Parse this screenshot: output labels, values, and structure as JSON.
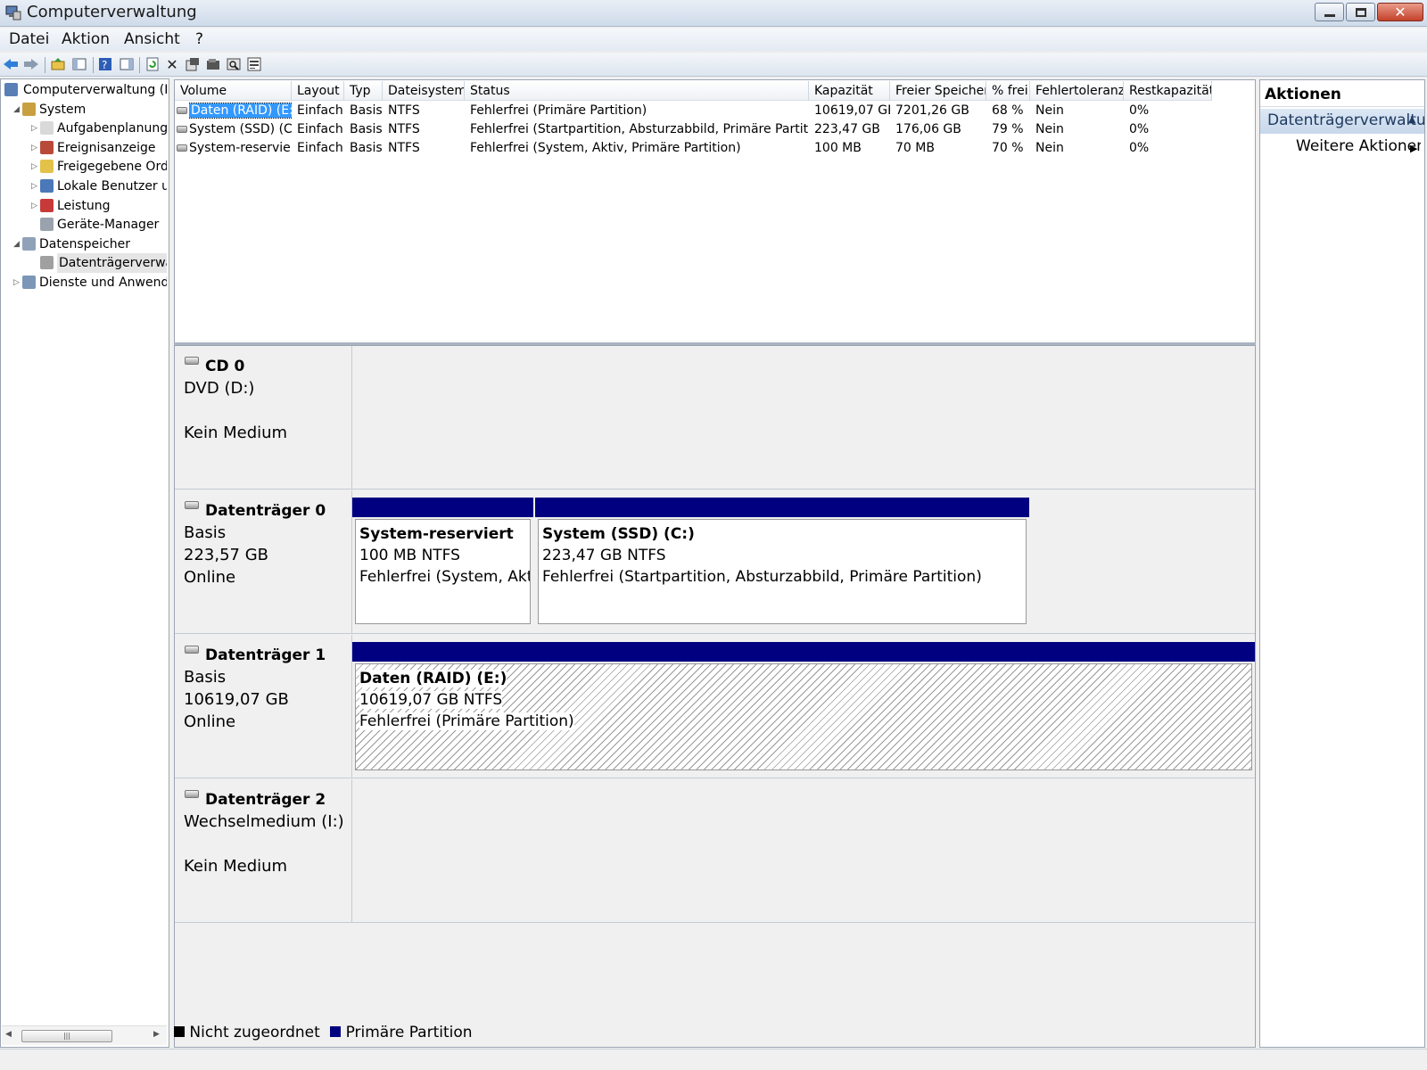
{
  "window": {
    "title": "Computerverwaltung"
  },
  "menu": [
    "Datei",
    "Aktion",
    "Ansicht",
    "?"
  ],
  "toolbar_icons": [
    "back-icon",
    "forward-icon",
    "up-folder-icon",
    "show-hide-tree-icon",
    "help-icon",
    "show-hide-action-pane-icon",
    "refresh-icon",
    "delete-icon",
    "properties-icon",
    "open-icon",
    "search-icon",
    "export-list-icon"
  ],
  "tree": [
    {
      "label": "Computerverwaltung (Lokal)",
      "level": 0,
      "expander": "",
      "icon": "computer-management-icon"
    },
    {
      "label": "System",
      "level": 1,
      "expander": "expanded",
      "icon": "system-tools-icon"
    },
    {
      "label": "Aufgabenplanung",
      "level": 2,
      "expander": "collapsed",
      "icon": "task-scheduler-icon"
    },
    {
      "label": "Ereignisanzeige",
      "level": 2,
      "expander": "collapsed",
      "icon": "event-viewer-icon"
    },
    {
      "label": "Freigegebene Ordner",
      "level": 2,
      "expander": "collapsed",
      "icon": "shared-folders-icon"
    },
    {
      "label": "Lokale Benutzer und Gruppen",
      "level": 2,
      "expander": "collapsed",
      "icon": "local-users-icon"
    },
    {
      "label": "Leistung",
      "level": 2,
      "expander": "collapsed",
      "icon": "performance-icon"
    },
    {
      "label": "Geräte-Manager",
      "level": 2,
      "expander": "",
      "icon": "device-manager-icon"
    },
    {
      "label": "Datenspeicher",
      "level": 1,
      "expander": "expanded",
      "icon": "storage-icon"
    },
    {
      "label": "Datenträgerverwaltung",
      "level": 2,
      "expander": "",
      "icon": "disk-management-icon",
      "selected": true
    },
    {
      "label": "Dienste und Anwendungen",
      "level": 1,
      "expander": "collapsed",
      "icon": "services-icon"
    }
  ],
  "volume_table": {
    "columns": [
      "Volume",
      "Layout",
      "Typ",
      "Dateisystem",
      "Status",
      "Kapazität",
      "Freier Speicher",
      "% frei",
      "Fehlertoleranz",
      "Restkapazität"
    ],
    "rows": [
      [
        "Daten (RAID) (E:)",
        "Einfach",
        "Basis",
        "NTFS",
        "Fehlerfrei (Primäre Partition)",
        "10619,07 GB",
        "7201,26 GB",
        "68 %",
        "Nein",
        "0%"
      ],
      [
        "System (SSD) (C:)",
        "Einfach",
        "Basis",
        "NTFS",
        "Fehlerfrei (Startpartition, Absturzabbild, Primäre Partition)",
        "223,47 GB",
        "176,06 GB",
        "79 %",
        "Nein",
        "0%"
      ],
      [
        "System-reserviert",
        "Einfach",
        "Basis",
        "NTFS",
        "Fehlerfrei (System, Aktiv, Primäre Partition)",
        "100 MB",
        "70 MB",
        "70 %",
        "Nein",
        "0%"
      ]
    ]
  },
  "disks": [
    {
      "name": "CD 0",
      "lines": [
        "DVD (D:)",
        "",
        "Kein Medium"
      ],
      "icon": "cd-drive-icon",
      "partitions": []
    },
    {
      "name": "Datenträger 0",
      "lines": [
        "Basis",
        "223,57 GB",
        "Online"
      ],
      "icon": "hard-disk-icon",
      "partitions": [
        {
          "name": "System-reserviert",
          "size": "100 MB NTFS",
          "status": "Fehlerfrei (System, Aktiv, Primäre Partition)"
        },
        {
          "name": "System (SSD)  (C:)",
          "size": "223,47 GB NTFS",
          "status": "Fehlerfrei (Startpartition, Absturzabbild, Primäre Partition)"
        }
      ]
    },
    {
      "name": "Datenträger 1",
      "lines": [
        "Basis",
        "10619,07 GB",
        "Online"
      ],
      "icon": "hard-disk-icon",
      "partitions": [
        {
          "name": "Daten (RAID)  (E:)",
          "size": "10619,07 GB NTFS",
          "status": "Fehlerfrei (Primäre Partition)"
        }
      ]
    },
    {
      "name": "Datenträger 2",
      "lines": [
        "Wechselmedium (I:)",
        "",
        "Kein Medium"
      ],
      "icon": "removable-disk-icon",
      "partitions": []
    }
  ],
  "legend": [
    {
      "label": "Nicht zugeordnet",
      "color": "#000000"
    },
    {
      "label": "Primäre Partition",
      "color": "#000080"
    }
  ],
  "actions": {
    "title": "Aktionen",
    "section": "Datenträgerverwaltung",
    "more": "Weitere Aktionen"
  },
  "colors": {
    "primary_partition": "#000080",
    "selection": "#3399ff"
  }
}
